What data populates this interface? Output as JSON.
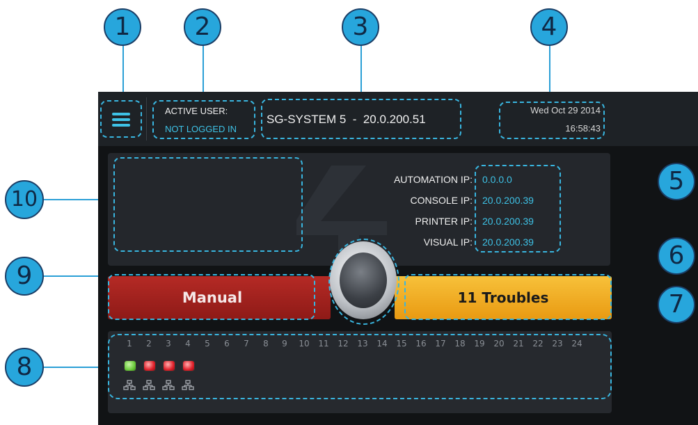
{
  "callouts": [
    "1",
    "2",
    "3",
    "4",
    "5",
    "6",
    "7",
    "8",
    "9",
    "10"
  ],
  "header": {
    "menu_icon": "hamburger-menu-icon",
    "active_user_label": "ACTIVE USER:",
    "active_user_value": "NOT LOGGED IN",
    "system_title": "SG-SYSTEM 5  -  20.0.200.51",
    "date": "Wed Oct 29 2014",
    "time": "16:58:43"
  },
  "ip_info": [
    {
      "label": "AUTOMATION IP:",
      "value": "0.0.0.0"
    },
    {
      "label": "CONSOLE IP:",
      "value": "20.0.200.39"
    },
    {
      "label": "PRINTER IP:",
      "value": "20.0.200.39"
    },
    {
      "label": "VISUAL IP:",
      "value": "20.0.200.39"
    }
  ],
  "mode_button": {
    "label": "Manual",
    "color": "#a8221f"
  },
  "troubles_button": {
    "label": "11 Troubles",
    "color": "#f2a922"
  },
  "center_knob_icon": "round-knob-button-icon",
  "channels": {
    "numbers": [
      "1",
      "2",
      "3",
      "4",
      "5",
      "6",
      "7",
      "8",
      "9",
      "10",
      "11",
      "12",
      "13",
      "14",
      "15",
      "16",
      "17",
      "18",
      "19",
      "20",
      "21",
      "22",
      "23",
      "24"
    ],
    "leds": [
      {
        "channel": "1",
        "status": "green",
        "color": "#6ccb3c"
      },
      {
        "channel": "2",
        "status": "red",
        "color": "#e0202a"
      },
      {
        "channel": "3",
        "status": "red",
        "color": "#e0202a"
      },
      {
        "channel": "4",
        "status": "red",
        "color": "#e0202a"
      }
    ],
    "network_icon": "network-icon"
  },
  "colors": {
    "accent": "#3ec2e6",
    "callout": "#27a6dc",
    "background": "#111315"
  }
}
